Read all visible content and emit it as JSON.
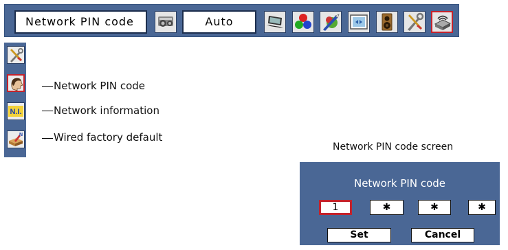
{
  "menubar": {
    "title": "Network PIN code",
    "mode_value": "Auto",
    "icons": [
      "projector-settings-icon",
      "laptop-input-icon",
      "color-balls-icon",
      "image-adjust-icon",
      "screen-icon",
      "speaker-icon",
      "tools-icon",
      "network-icon"
    ]
  },
  "submenu": {
    "items": [
      {
        "icon": "wrench-screwdriver-icon",
        "label": ""
      },
      {
        "icon": "head-profile-icon",
        "label": "Network PIN code"
      },
      {
        "icon": "ni-badge-icon",
        "badge": "N.I.",
        "label": "Network information"
      },
      {
        "icon": "factory-default-icon",
        "label": "Wired factory default"
      }
    ]
  },
  "screen_caption": "Network PIN code screen",
  "dialog": {
    "title": "Network PIN code",
    "digits": [
      "1",
      "✱",
      "✱",
      "✱"
    ],
    "set_label": "Set",
    "cancel_label": "Cancel"
  },
  "colors": {
    "panel": "#4a6795",
    "highlight": "#c4222b"
  }
}
